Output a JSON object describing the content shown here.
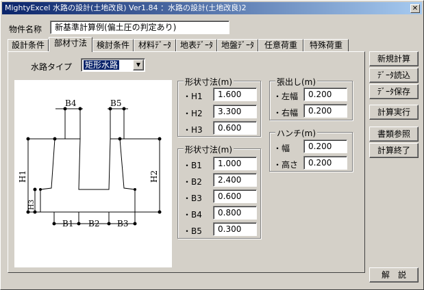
{
  "window": {
    "title": "MightyExcel 水路の設計(土地改良) Ver1.84 ：水路の設計(土地改良)2",
    "close_symbol": "✕"
  },
  "project": {
    "label": "物件名称",
    "value": "新基準計算例(偏土圧の判定あり)"
  },
  "tabs": [
    {
      "label": "設計条件",
      "active": false
    },
    {
      "label": "部材寸法",
      "active": true
    },
    {
      "label": "検討条件",
      "active": false
    },
    {
      "label": "材料ﾃﾞｰﾀ",
      "active": false
    },
    {
      "label": "地表ﾃﾞｰﾀ",
      "active": false
    },
    {
      "label": "地盤ﾃﾞｰﾀ",
      "active": false
    },
    {
      "label": "任意荷重",
      "active": false
    },
    {
      "label": "特殊荷重",
      "active": false
    }
  ],
  "channel_type": {
    "label": "水路タイプ",
    "value": "矩形水路"
  },
  "diagram": {
    "labels": {
      "b4": "B4",
      "b5": "B5",
      "h1": "H1",
      "h2": "H2",
      "h3": "H3",
      "b1": "B1",
      "b2": "B2",
      "b3": "B3"
    }
  },
  "shape_h": {
    "title": "形状寸法(m)",
    "rows": [
      {
        "label": "・H1",
        "value": "1.600"
      },
      {
        "label": "・H2",
        "value": "3.300"
      },
      {
        "label": "・H3",
        "value": "0.600"
      }
    ]
  },
  "shape_b": {
    "title": "形状寸法(m)",
    "rows": [
      {
        "label": "・B1",
        "value": "1.000"
      },
      {
        "label": "・B2",
        "value": "2.400"
      },
      {
        "label": "・B3",
        "value": "0.600"
      },
      {
        "label": "・B4",
        "value": "0.800"
      },
      {
        "label": "・B5",
        "value": "0.300"
      }
    ]
  },
  "overhang": {
    "title": "張出し(m)",
    "rows": [
      {
        "label": "・左幅",
        "value": "0.200"
      },
      {
        "label": "・右幅",
        "value": "0.200"
      }
    ]
  },
  "haunch": {
    "title": "ハンチ(m)",
    "rows": [
      {
        "label": "・幅",
        "value": "0.200"
      },
      {
        "label": "・高さ",
        "value": "0.200"
      }
    ]
  },
  "buttons": {
    "new_calc": "新規計算",
    "load_data": "ﾃﾞｰﾀ読込",
    "save_data": "ﾃﾞｰﾀ保存",
    "run_calc": "計算実行",
    "documents": "書類参照",
    "end_calc": "計算終了",
    "help": "解　説"
  }
}
